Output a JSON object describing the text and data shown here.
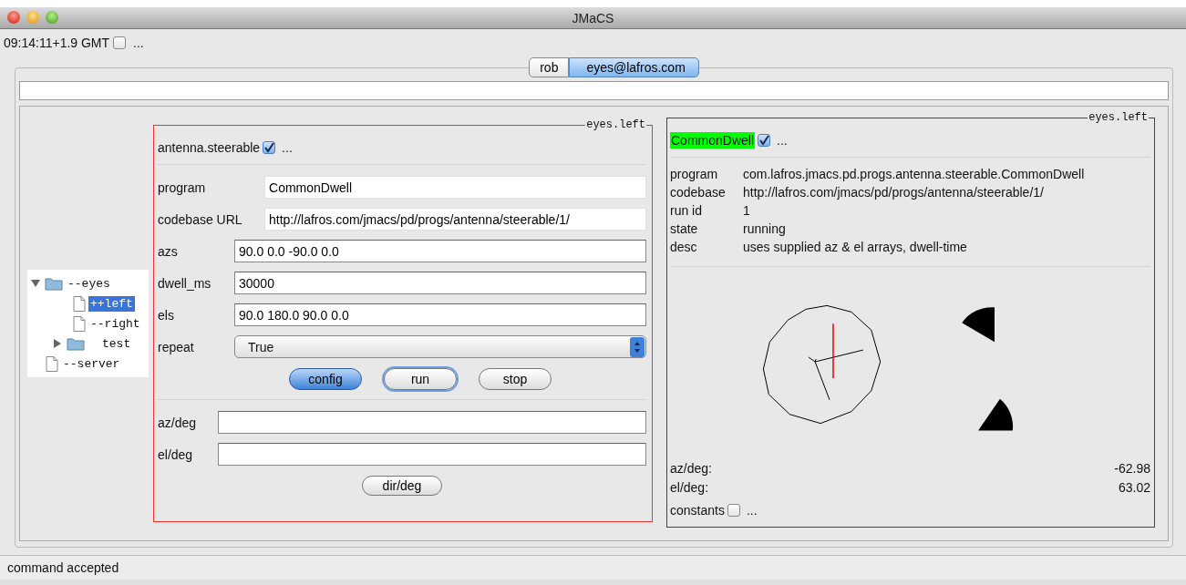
{
  "window": {
    "title": "JMaCS"
  },
  "clock": {
    "time": "09:14:11+1.9 GMT",
    "checked": false,
    "more": "..."
  },
  "tabs": [
    {
      "label": "rob",
      "selected": false
    },
    {
      "label": "eyes@lafros.com",
      "selected": true
    }
  ],
  "tree": [
    {
      "label": "--eyes",
      "kind": "folder",
      "expanded": true,
      "selected": false,
      "children": [
        {
          "label": "++left",
          "kind": "file",
          "selected": true
        },
        {
          "label": "--right",
          "kind": "file",
          "selected": false
        },
        {
          "label": "test",
          "kind": "folder",
          "expanded": false,
          "selected": false
        }
      ]
    },
    {
      "label": "--server",
      "kind": "file",
      "selected": false
    }
  ],
  "control_panel": {
    "title": "eyes.left",
    "type": "antenna.steerable",
    "checked": true,
    "more": "...",
    "program_fields": [
      {
        "label": "program",
        "value": "CommonDwell"
      },
      {
        "label": "codebase URL",
        "value": "http://lafros.com/jmacs/pd/progs/antenna/steerable/1/"
      }
    ],
    "array_fields": [
      {
        "label": "azs",
        "value": "90.0 0.0 -90.0 0.0"
      },
      {
        "label": "dwell_ms",
        "value": "30000"
      },
      {
        "label": "els",
        "value": "90.0 180.0 90.0 0.0"
      }
    ],
    "repeat": {
      "label": "repeat",
      "value": "True"
    },
    "buttons": [
      {
        "label": "config",
        "kind": "default"
      },
      {
        "label": "run",
        "kind": "focused"
      },
      {
        "label": "stop",
        "kind": "plain"
      }
    ],
    "outputs": [
      {
        "label": "az/deg"
      },
      {
        "label": "el/deg"
      }
    ],
    "dir_button": "dir/deg"
  },
  "status_panel": {
    "title": "eyes.left",
    "program": "CommonDwell",
    "highlighted": true,
    "checked": true,
    "more": "...",
    "info": [
      {
        "label": "program",
        "value": "com.lafros.jmacs.pd.progs.antenna.steerable.CommonDwell"
      },
      {
        "label": "codebase",
        "value": "http://lafros.com/jmacs/pd/progs/antenna/steerable/1/"
      },
      {
        "label": "run id",
        "value": "1"
      },
      {
        "label": "state",
        "value": "running"
      },
      {
        "label": "desc",
        "value": "uses supplied az & el arrays, dwell-time"
      }
    ],
    "readings": [
      {
        "label": "az/deg:",
        "value": "-62.98"
      },
      {
        "label": "el/deg:",
        "value": "63.02"
      }
    ],
    "constants": {
      "label": "constants",
      "checked": false,
      "more": "..."
    }
  },
  "status_bar": "command accepted"
}
